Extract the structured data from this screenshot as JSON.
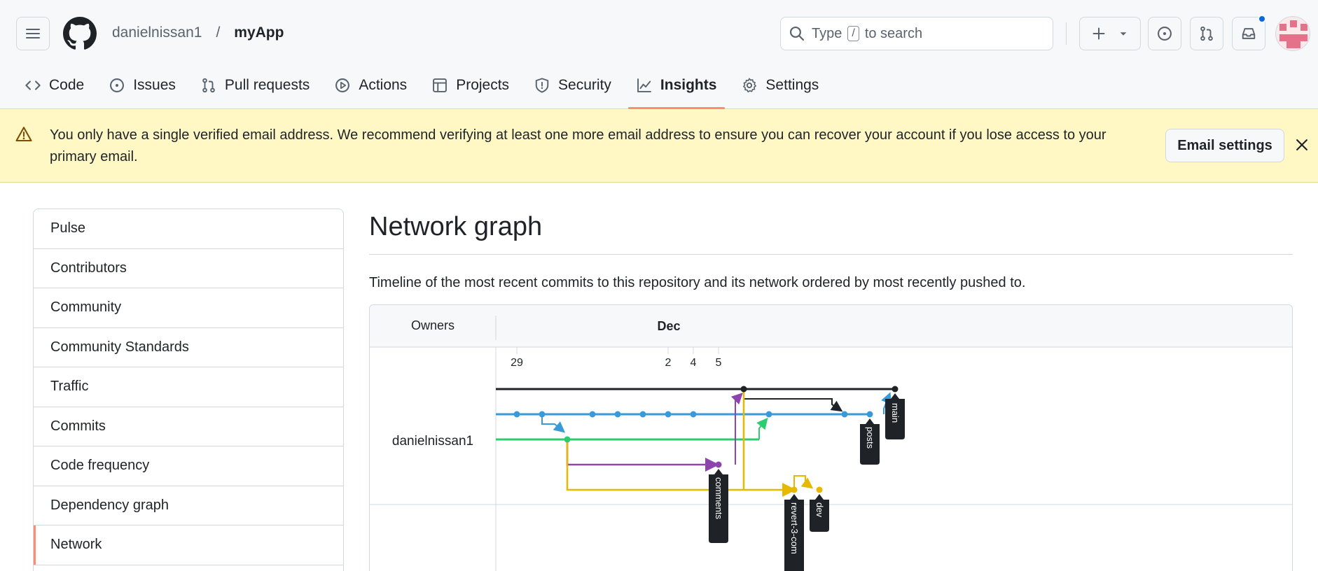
{
  "header": {
    "owner": "danielnissan1",
    "separator": "/",
    "repo": "myApp",
    "search_prefix": "Type",
    "search_key": "/",
    "search_suffix": "to search"
  },
  "tabs": [
    {
      "label": "Code",
      "icon": "code-icon"
    },
    {
      "label": "Issues",
      "icon": "issue-icon"
    },
    {
      "label": "Pull requests",
      "icon": "pull-request-icon"
    },
    {
      "label": "Actions",
      "icon": "play-icon"
    },
    {
      "label": "Projects",
      "icon": "table-icon"
    },
    {
      "label": "Security",
      "icon": "shield-icon"
    },
    {
      "label": "Insights",
      "icon": "graph-icon",
      "active": true
    },
    {
      "label": "Settings",
      "icon": "gear-icon"
    }
  ],
  "banner": {
    "message": "You only have a single verified email address. We recommend verifying at least one more email address to ensure you can recover your account if you lose access to your primary email.",
    "button": "Email settings"
  },
  "sidebar": {
    "items": [
      {
        "label": "Pulse"
      },
      {
        "label": "Contributors"
      },
      {
        "label": "Community"
      },
      {
        "label": "Community Standards"
      },
      {
        "label": "Traffic"
      },
      {
        "label": "Commits"
      },
      {
        "label": "Code frequency"
      },
      {
        "label": "Dependency graph"
      },
      {
        "label": "Network",
        "selected": true
      }
    ]
  },
  "main": {
    "title": "Network graph",
    "subtitle": "Timeline of the most recent commits to this repository and its network ordered by most recently pushed to."
  },
  "network": {
    "owners_header": "Owners",
    "month": "Dec",
    "dates": [
      "29",
      "2",
      "4",
      "5"
    ],
    "owner": "danielnissan1",
    "branches": [
      "main",
      "posts",
      "comments",
      "revert-3-com",
      "dev"
    ],
    "colors": {
      "black": "#1f2328",
      "blue": "#3a9ad9",
      "green": "#2ecc71",
      "purple": "#8e44ad",
      "yellow": "#e6b800"
    }
  }
}
